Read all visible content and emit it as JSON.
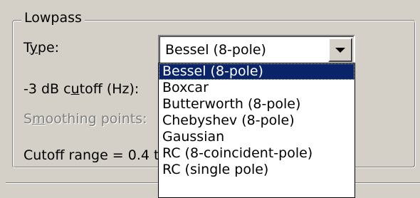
{
  "group": {
    "title": "Lowpass"
  },
  "fields": {
    "type_label": "Type:",
    "cutoff_label": "-3 dB cutoff (Hz):",
    "smoothing_label": "Smoothing points:",
    "range_text": "Cutoff range = 0.4 t"
  },
  "type_select": {
    "value": "Bessel (8-pole)",
    "options": [
      "Bessel (8-pole)",
      "Boxcar",
      "Butterworth (8-pole)",
      "Chebyshev (8-pole)",
      "Gaussian",
      "RC (8-coincident-pole)",
      "RC (single pole)"
    ],
    "selected_index": 0
  },
  "colors": {
    "background": "#d4d0c8",
    "highlight": "#0a246a",
    "disabled_text": "#808080"
  },
  "icons": {
    "dropdown_button": "chevron-down-icon"
  }
}
